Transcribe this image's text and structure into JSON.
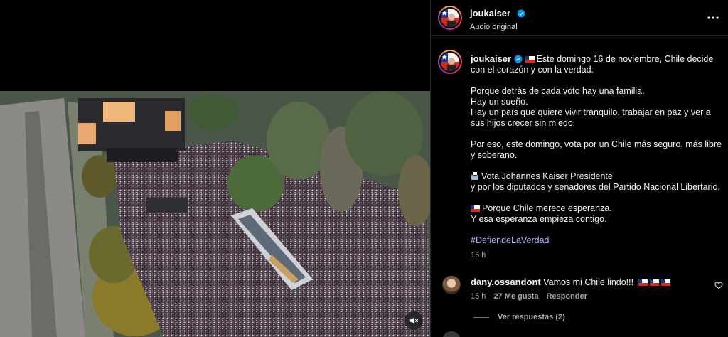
{
  "post": {
    "username": "joukaiser",
    "audio_label": "Audio original"
  },
  "caption": {
    "username": "joukaiser",
    "line1": "Este domingo 16 de noviembre, Chile decide con el corazón y con la verdad.",
    "p2_l1": "Porque detrás de cada voto hay una familia.",
    "p2_l2": "Hay un sueño.",
    "p2_l3": "Hay un país que quiere vivir tranquilo, trabajar en paz y ver a sus hijos crecer sin miedo.",
    "p3": "Por eso, este domingo, vota por un Chile más seguro, más libre y soberano.",
    "p4_l1": "Vota Johannes Kaiser Presidente",
    "p4_l2": "y por los diputados y senadores del Partido Nacional Libertario.",
    "p5_l1": "Porque Chile merece esperanza.",
    "p5_l2": "Y esa esperanza empieza contigo.",
    "hashtag": "#DefiendeLaVerdad",
    "time": "15 h"
  },
  "comment": {
    "username": "dany.ossandont",
    "text": "Vamos mi Chile lindo!!!",
    "time": "15 h",
    "likes": "27 Me gusta",
    "reply_label": "Responder",
    "view_replies": "Ver respuestas (2)"
  },
  "icons": {
    "verified": "verified-badge-icon",
    "more": "more-options-icon",
    "mute": "muted-speaker-icon",
    "like": "heart-icon",
    "flag": "chile-flag-emoji",
    "ballot": "ballot-box-emoji"
  },
  "colors": {
    "background": "#000000",
    "verified_blue": "#0095f6",
    "hashtag": "#a3b5ff",
    "secondary_text": "#a8a8a8"
  }
}
